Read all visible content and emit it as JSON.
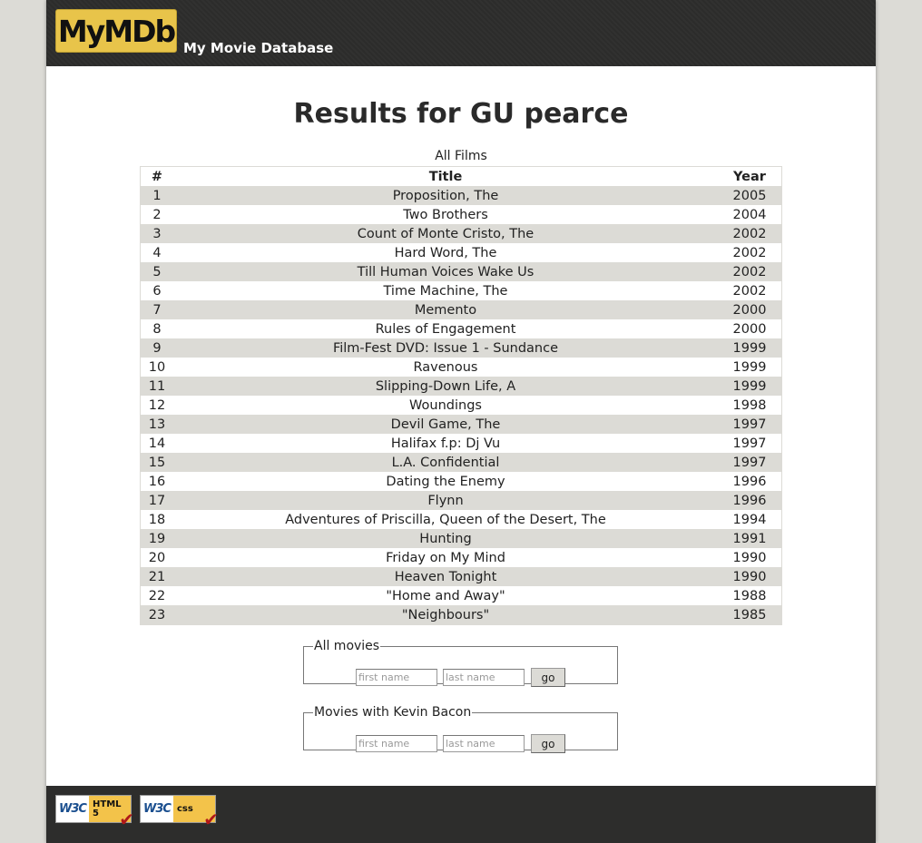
{
  "header": {
    "logo_text": "MyMDb",
    "site_name": "My Movie Database"
  },
  "main": {
    "title": "Results for GU pearce",
    "table": {
      "caption": "All Films",
      "columns": [
        "#",
        "Title",
        "Year"
      ],
      "rows": [
        [
          "1",
          "Proposition, The",
          "2005"
        ],
        [
          "2",
          "Two Brothers",
          "2004"
        ],
        [
          "3",
          "Count of Monte Cristo, The",
          "2002"
        ],
        [
          "4",
          "Hard Word, The",
          "2002"
        ],
        [
          "5",
          "Till Human Voices Wake Us",
          "2002"
        ],
        [
          "6",
          "Time Machine, The",
          "2002"
        ],
        [
          "7",
          "Memento",
          "2000"
        ],
        [
          "8",
          "Rules of Engagement",
          "2000"
        ],
        [
          "9",
          "Film-Fest DVD: Issue 1 - Sundance",
          "1999"
        ],
        [
          "10",
          "Ravenous",
          "1999"
        ],
        [
          "11",
          "Slipping-Down Life, A",
          "1999"
        ],
        [
          "12",
          "Woundings",
          "1998"
        ],
        [
          "13",
          "Devil Game, The",
          "1997"
        ],
        [
          "14",
          "Halifax f.p: Dj Vu",
          "1997"
        ],
        [
          "15",
          "L.A. Confidential",
          "1997"
        ],
        [
          "16",
          "Dating the Enemy",
          "1996"
        ],
        [
          "17",
          "Flynn",
          "1996"
        ],
        [
          "18",
          "Adventures of Priscilla, Queen of the Desert, The",
          "1994"
        ],
        [
          "19",
          "Hunting",
          "1991"
        ],
        [
          "20",
          "Friday on My Mind",
          "1990"
        ],
        [
          "21",
          "Heaven Tonight",
          "1990"
        ],
        [
          "22",
          "\"Home and Away\"",
          "1988"
        ],
        [
          "23",
          "\"Neighbours\"",
          "1985"
        ]
      ]
    }
  },
  "search_forms": [
    {
      "legend": "All movies",
      "first_placeholder": "first name",
      "last_placeholder": "last name",
      "button_label": "go"
    },
    {
      "legend": "Movies with Kevin Bacon",
      "first_placeholder": "first name",
      "last_placeholder": "last name",
      "button_label": "go"
    }
  ],
  "footer": {
    "badges": [
      {
        "w3c": "W3C",
        "label_line1": "HTML",
        "label_line2": "5",
        "check": "✔"
      },
      {
        "w3c": "W3C",
        "label_line1": "css",
        "label_line2": "",
        "check": "✔"
      }
    ]
  },
  "colors": {
    "header_bg": "#2d2d2c",
    "logo_bg": "#e8c44a",
    "row_stripe": "#dcdbd6",
    "page_bg": "#dcdbd6"
  }
}
